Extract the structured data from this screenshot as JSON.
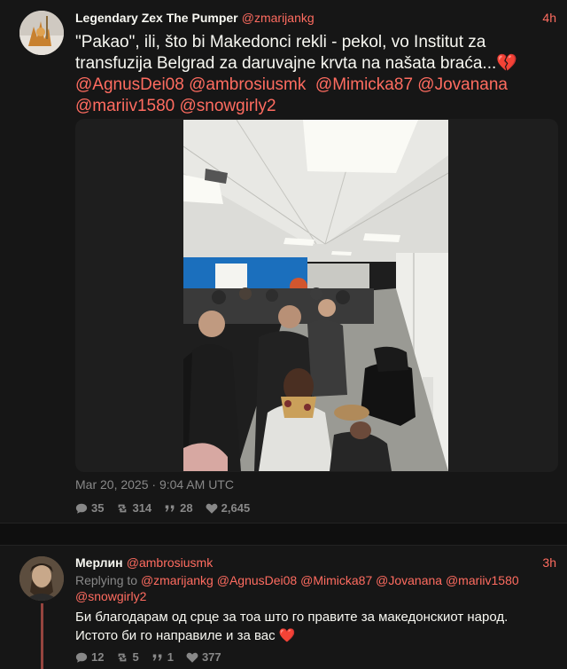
{
  "main_tweet": {
    "display_name": "Legendary Zex The Pumper",
    "handle": "@zmarijankg",
    "time": "4h",
    "text_start": "\"Pakao\", ili, što bi Makedonci rekli - pekol, vo Institut za transfuzija Belgrad za daruvajne krvta na našata braća...💔",
    "mentions": [
      "@AgnusDei08",
      "@ambrosiusmk",
      "@Mimicka87",
      "@Jovanana",
      "@mariiv1580",
      "@snowgirly2"
    ],
    "date": "Mar 20, 2025 · 9:04 AM UTC",
    "stats": {
      "replies": "35",
      "retweets": "314",
      "quotes": "28",
      "likes": "2,645"
    }
  },
  "reply_tweet": {
    "display_name": "Мерлин",
    "handle": "@ambrosiusmk",
    "time": "3h",
    "replying_label": "Replying to",
    "replying_to": [
      "@zmarijankg",
      "@AgnusDei08",
      "@Mimicka87",
      "@Jovanana",
      "@mariiv1580",
      "@snowgirly2"
    ],
    "text": "Би благодарам од срце за тоа што го правите за македонскиот народ. Истото би го направиле и за вас ❤️",
    "stats": {
      "replies": "12",
      "retweets": "5",
      "quotes": "1",
      "likes": "377"
    }
  },
  "icons": {
    "reply": "comment-icon",
    "retweet": "retweet-icon",
    "quote": "quote-icon",
    "like": "heart-icon"
  },
  "colors": {
    "accent": "#ff6c60",
    "background": "#161616",
    "muted": "#888888",
    "text": "#f8f8f2"
  }
}
